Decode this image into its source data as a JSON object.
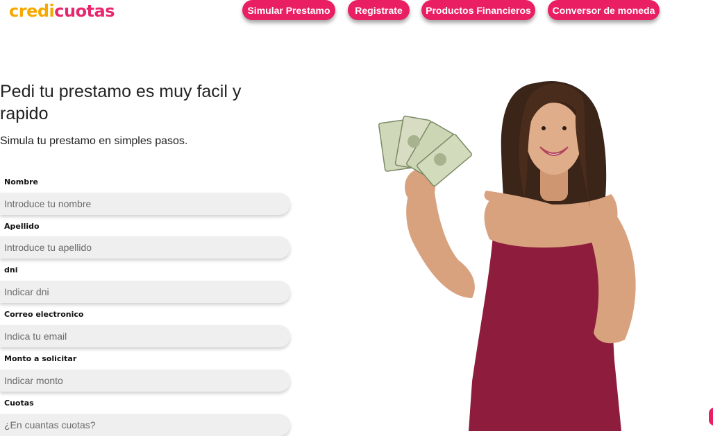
{
  "brand": {
    "part1": "credi",
    "part2": "cuotas",
    "color1": "#f6a800",
    "color2": "#e8266e"
  },
  "nav": {
    "items": [
      {
        "label": "Simular Prestamo"
      },
      {
        "label": "Registrate"
      },
      {
        "label": "Productos Financieros"
      },
      {
        "label": "Conversor de moneda"
      }
    ],
    "accent": "#e91e63"
  },
  "hero": {
    "title": "Pedi tu prestamo es muy facil y rapido",
    "subtitle": "Simula tu prestamo en simples pasos."
  },
  "form": {
    "fields": [
      {
        "label": "Nombre",
        "placeholder": "Introduce tu nombre"
      },
      {
        "label": "Apellido",
        "placeholder": "Introduce tu apellido"
      },
      {
        "label": "dni",
        "placeholder": "Indicar dni"
      },
      {
        "label": "Correo electronico",
        "placeholder": "Indica tu email"
      },
      {
        "label": "Monto a solicitar",
        "placeholder": "Indicar monto"
      },
      {
        "label": "Cuotas",
        "placeholder": "¿En cuantas cuotas?"
      }
    ]
  },
  "illustration": {
    "icon": "woman-holding-money-photo"
  }
}
